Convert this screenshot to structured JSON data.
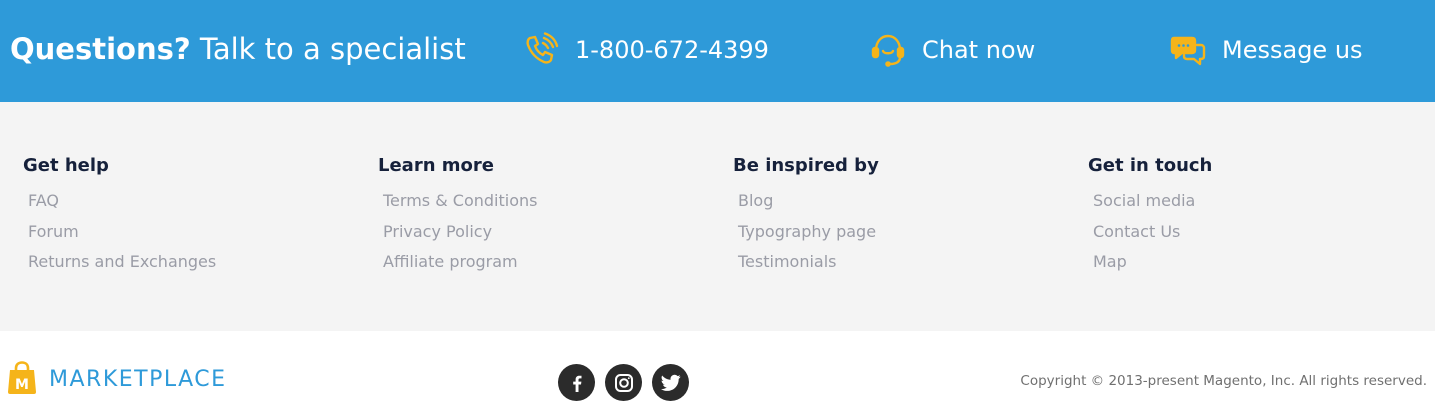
{
  "colors": {
    "contact_bar": "#2e9ad9",
    "icon_accent": "#f5b41a",
    "heading": "#16213b",
    "link": "#9a9ca6",
    "brand": "#2e9ad9"
  },
  "contact_bar": {
    "questions_strong": "Questions?",
    "questions_rest": " Talk to a specialist",
    "items": [
      {
        "icon": "phone-icon",
        "label": "1-800-672-4399"
      },
      {
        "icon": "headset-icon",
        "label": "Chat now"
      },
      {
        "icon": "speech-bubbles-icon",
        "label": "Message us"
      }
    ]
  },
  "columns": [
    {
      "heading": "Get help",
      "links": [
        "FAQ",
        "Forum",
        "Returns and Exchanges"
      ]
    },
    {
      "heading": "Learn more",
      "links": [
        "Terms & Conditions",
        "Privacy Policy",
        "Affiliate program"
      ]
    },
    {
      "heading": "Be inspired by",
      "links": [
        "Blog",
        "Typography page",
        "Testimonials"
      ]
    },
    {
      "heading": "Get in touch",
      "links": [
        "Social media",
        "Contact Us",
        "Map"
      ]
    }
  ],
  "bottom": {
    "brand_name": "MARKETPLACE",
    "brand_logo_letter": "M",
    "socials": [
      "facebook-icon",
      "instagram-icon",
      "twitter-icon"
    ],
    "copyright": "Copyright © 2013-present Magento, Inc. All rights reserved."
  }
}
